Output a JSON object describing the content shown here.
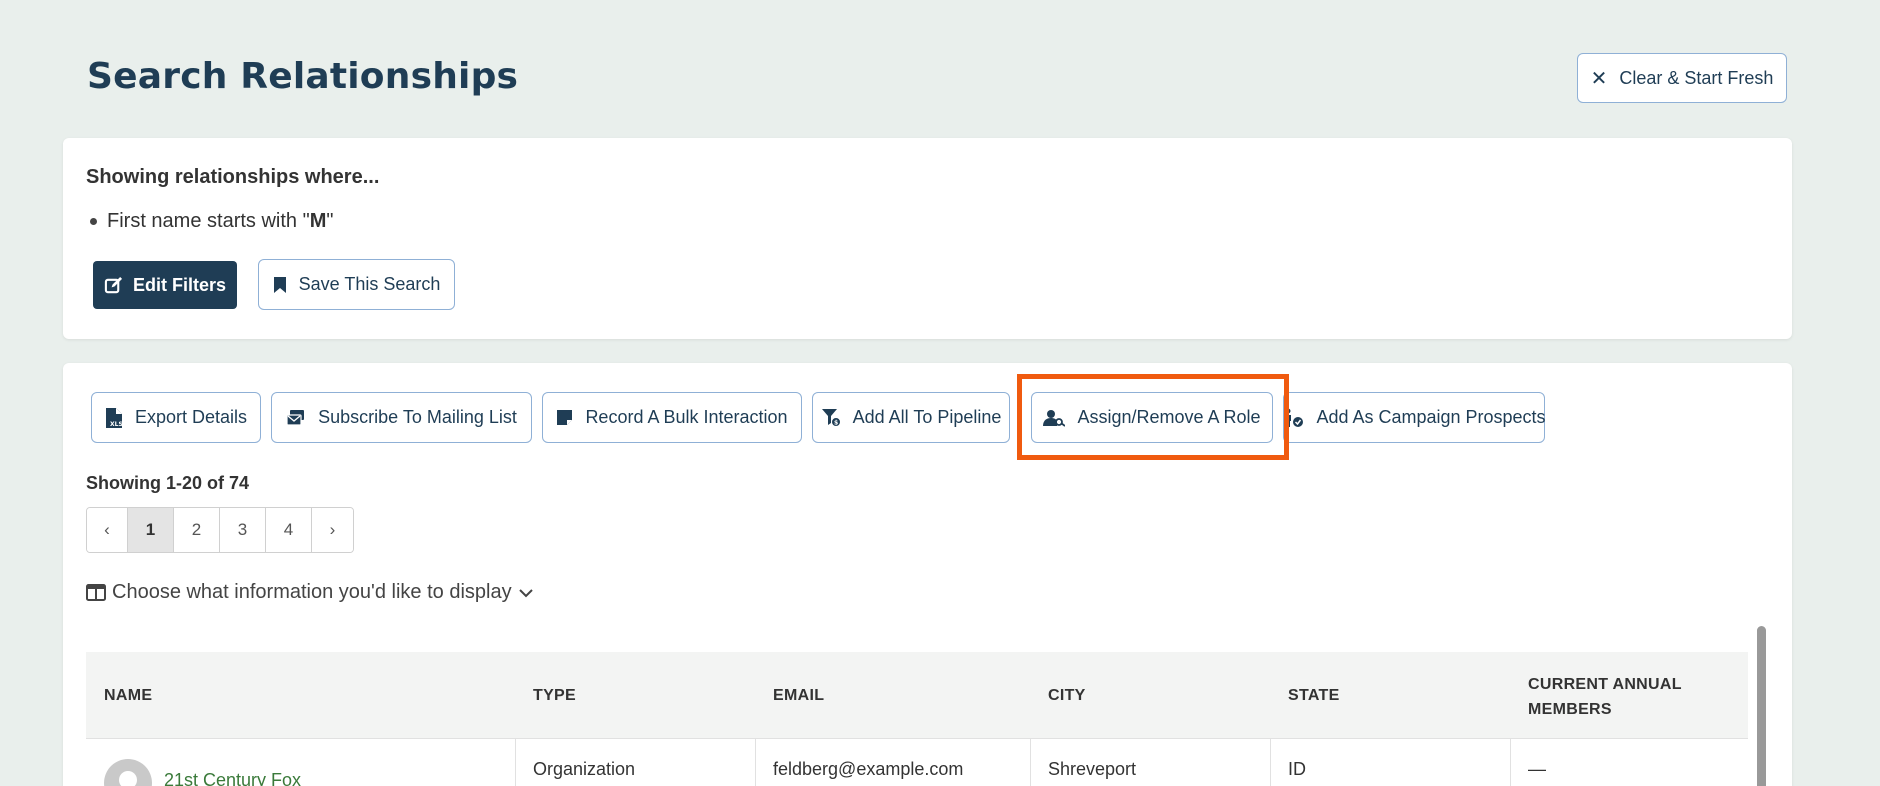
{
  "page": {
    "title": "Search Relationships",
    "clear_label": "Clear & Start Fresh"
  },
  "filters": {
    "heading": "Showing relationships where...",
    "items": [
      {
        "prefix": "First name starts with \"",
        "value": "M",
        "suffix": "\""
      }
    ],
    "edit_label": "Edit Filters",
    "save_label": "Save This Search"
  },
  "actions": [
    {
      "label": "Export Details",
      "icon": "xls-file-icon"
    },
    {
      "label": "Subscribe To Mailing List",
      "icon": "mailing-list-icon"
    },
    {
      "label": "Record A Bulk Interaction",
      "icon": "note-icon"
    },
    {
      "label": "Add All To Pipeline",
      "icon": "funnel-icon"
    },
    {
      "label": "Assign/Remove A Role",
      "icon": "user-key-icon",
      "highlighted": true
    },
    {
      "label": "Add As Campaign Prospects",
      "icon": "person-check-icon"
    }
  ],
  "results": {
    "showing": "Showing 1-20 of 74",
    "pager": {
      "prev": "‹",
      "pages": [
        "1",
        "2",
        "3",
        "4"
      ],
      "active": "1",
      "next": "›"
    },
    "display_toggle": "Choose what information you'd like to display"
  },
  "table": {
    "columns": [
      "NAME",
      "TYPE",
      "EMAIL",
      "CITY",
      "STATE",
      "CURRENT ANNUAL MEMBERS"
    ],
    "rows": [
      {
        "name": "21st Century Fox",
        "type": "Organization",
        "email": "feldberg@example.com",
        "city": "Shreveport",
        "state": "ID",
        "members": "—"
      }
    ]
  },
  "colors": {
    "primary": "#1f3d55",
    "highlight": "#f05a0f",
    "link": "#3a7a3a",
    "background": "#e9efec"
  }
}
